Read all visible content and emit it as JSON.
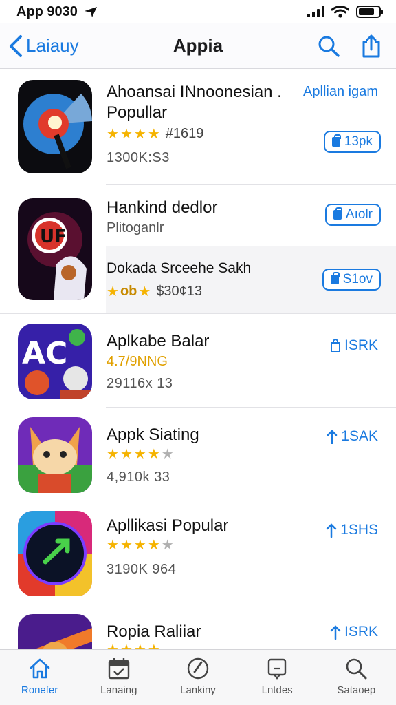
{
  "status_bar": {
    "time": "App 9030"
  },
  "nav": {
    "back_label": "Laiauy",
    "title": "Appia"
  },
  "apps": [
    {
      "title": "Ahoansai INnoonesian .",
      "title2": "Popullar",
      "rating_text": "#1619",
      "stars": 4,
      "meta": "1300K:S3",
      "side_link": "Apllian igam",
      "button": "13pk"
    },
    {
      "title": "Hankind dedlor",
      "subtitle": "Plitoganlr",
      "button": "Aıolr"
    },
    {
      "title": "Dokada Srceehe Sakh",
      "rating_badge": "ob",
      "rating_text": "$30¢13",
      "button": "S1ov"
    },
    {
      "title": "Aplkabe Balar",
      "rating_text": "4.7/9NNG",
      "meta": "29116x 13",
      "button": "ISRK"
    },
    {
      "title": "Appk Siating",
      "stars": 4,
      "meta": "4,910k 33",
      "button": "1SAK"
    },
    {
      "title": "Apllikasi Popular",
      "stars": 4,
      "meta": "3190K 964",
      "button": "1SHS"
    },
    {
      "title": "Ropia Raliiar",
      "button": "ISRK"
    }
  ],
  "tabs": [
    {
      "label": "Ronefer",
      "icon": "home-icon",
      "active": true
    },
    {
      "label": "Lanaing",
      "icon": "calendar-icon",
      "active": false
    },
    {
      "label": "Lankiny",
      "icon": "compass-icon",
      "active": false
    },
    {
      "label": "Lntdes",
      "icon": "chat-icon",
      "active": false
    },
    {
      "label": "Sataoep",
      "icon": "search-icon",
      "active": false
    }
  ],
  "colors": {
    "accent": "#1a7ae0",
    "star": "#f5b301"
  }
}
